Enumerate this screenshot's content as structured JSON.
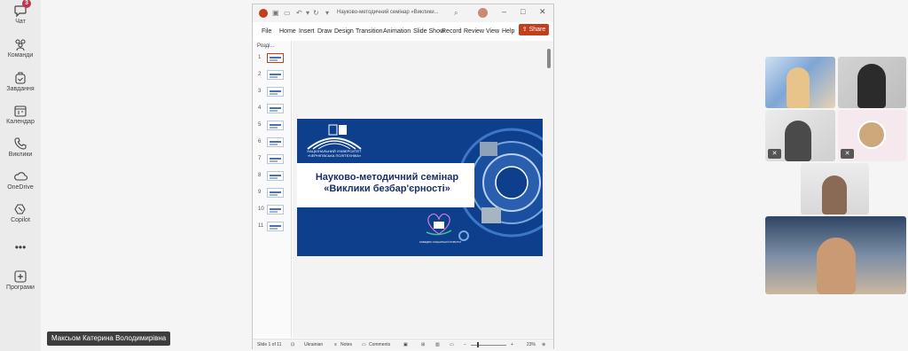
{
  "rail": {
    "items": [
      {
        "label": "Чат",
        "icon": "chat-icon",
        "badge": "3"
      },
      {
        "label": "Команди",
        "icon": "teams-icon"
      },
      {
        "label": "Завдання",
        "icon": "tasks-icon"
      },
      {
        "label": "Календар",
        "icon": "calendar-icon"
      },
      {
        "label": "Виклики",
        "icon": "calls-icon"
      },
      {
        "label": "OneDrive",
        "icon": "onedrive-icon"
      },
      {
        "label": "Copilot",
        "icon": "copilot-icon"
      },
      {
        "label": "",
        "icon": "more-icon",
        "symbol": "•••"
      },
      {
        "label": "Програми",
        "icon": "apps-icon"
      }
    ]
  },
  "ppt": {
    "doc_title": "Науково-методичний семінар «Виклики...",
    "menu": [
      "File",
      "Home",
      "Insert",
      "Draw",
      "Design",
      "Transition",
      "Animation",
      "Slide Show",
      "Record",
      "Review",
      "View",
      "Help"
    ],
    "share_label": "Share",
    "thumbs_header": "Розді...",
    "slide_numbers": [
      "1",
      "2",
      "3",
      "4",
      "5",
      "6",
      "7",
      "8",
      "9",
      "10",
      "11"
    ],
    "active_slide": 1,
    "slide": {
      "title_line1": "Науково-методичний семінар",
      "title_line2": "«Виклики безбар'єрності»",
      "university_line1": "НАЦІОНАЛЬНИЙ УНІВЕРСИТЕТ",
      "university_line2": "«ЧЕРНІГІВСЬКА ПОЛІТЕХНІКА»",
      "department": "КАФЕДРА СОЦІАЛЬНОЇ РОБОТИ"
    },
    "status": {
      "slide_of": "Slide 1 of 11",
      "language": "Ukrainian",
      "notes": "Notes",
      "comments": "Comments",
      "zoom": "23%"
    }
  },
  "meeting": {
    "presenter_name": "Максьом Катерина Володимирівна"
  },
  "colors": {
    "rail_bg": "#ebebeb",
    "ppt_accent": "#c43e1c",
    "slide_blue": "#0d3f8c",
    "badge": "#c4314b"
  }
}
